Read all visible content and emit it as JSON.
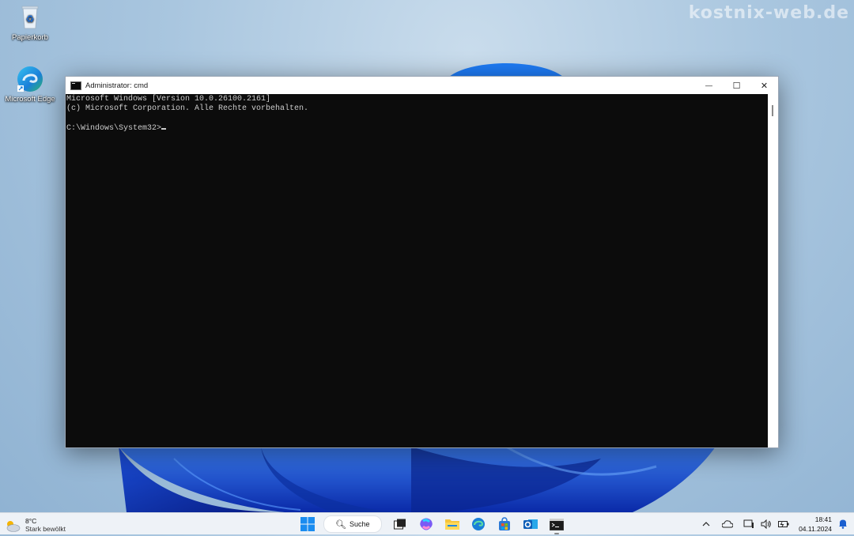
{
  "watermark": "kostnix-web.de",
  "desktop": {
    "icons": [
      {
        "label": "Papierkorb",
        "icon": "recycle-bin-icon"
      },
      {
        "label": "Microsoft Edge",
        "icon": "edge-icon"
      }
    ]
  },
  "window": {
    "title": "Administrator: cmd",
    "controls": {
      "minimize": "—",
      "maximize": "☐",
      "close": "✕"
    },
    "console_lines": [
      "Microsoft Windows [Version 10.0.26100.2161]",
      "(c) Microsoft Corporation. Alle Rechte vorbehalten.",
      "",
      "C:\\Windows\\System32>"
    ],
    "colors": {
      "console_bg": "#0c0c0c",
      "console_fg": "#cccccc"
    }
  },
  "taskbar": {
    "weather": {
      "temp": "8°C",
      "desc": "Stark bewölkt"
    },
    "search_label": "Suche",
    "apps": [
      "start-icon",
      "task-view-icon",
      "copilot-icon",
      "file-explorer-icon",
      "edge-icon",
      "store-icon",
      "outlook-icon",
      "terminal-icon"
    ],
    "clock": {
      "time": "18:41",
      "date": "04.11.2024"
    },
    "tray": [
      "chevron-up-icon",
      "onedrive-icon",
      "network-icon",
      "volume-icon",
      "battery-icon"
    ]
  }
}
